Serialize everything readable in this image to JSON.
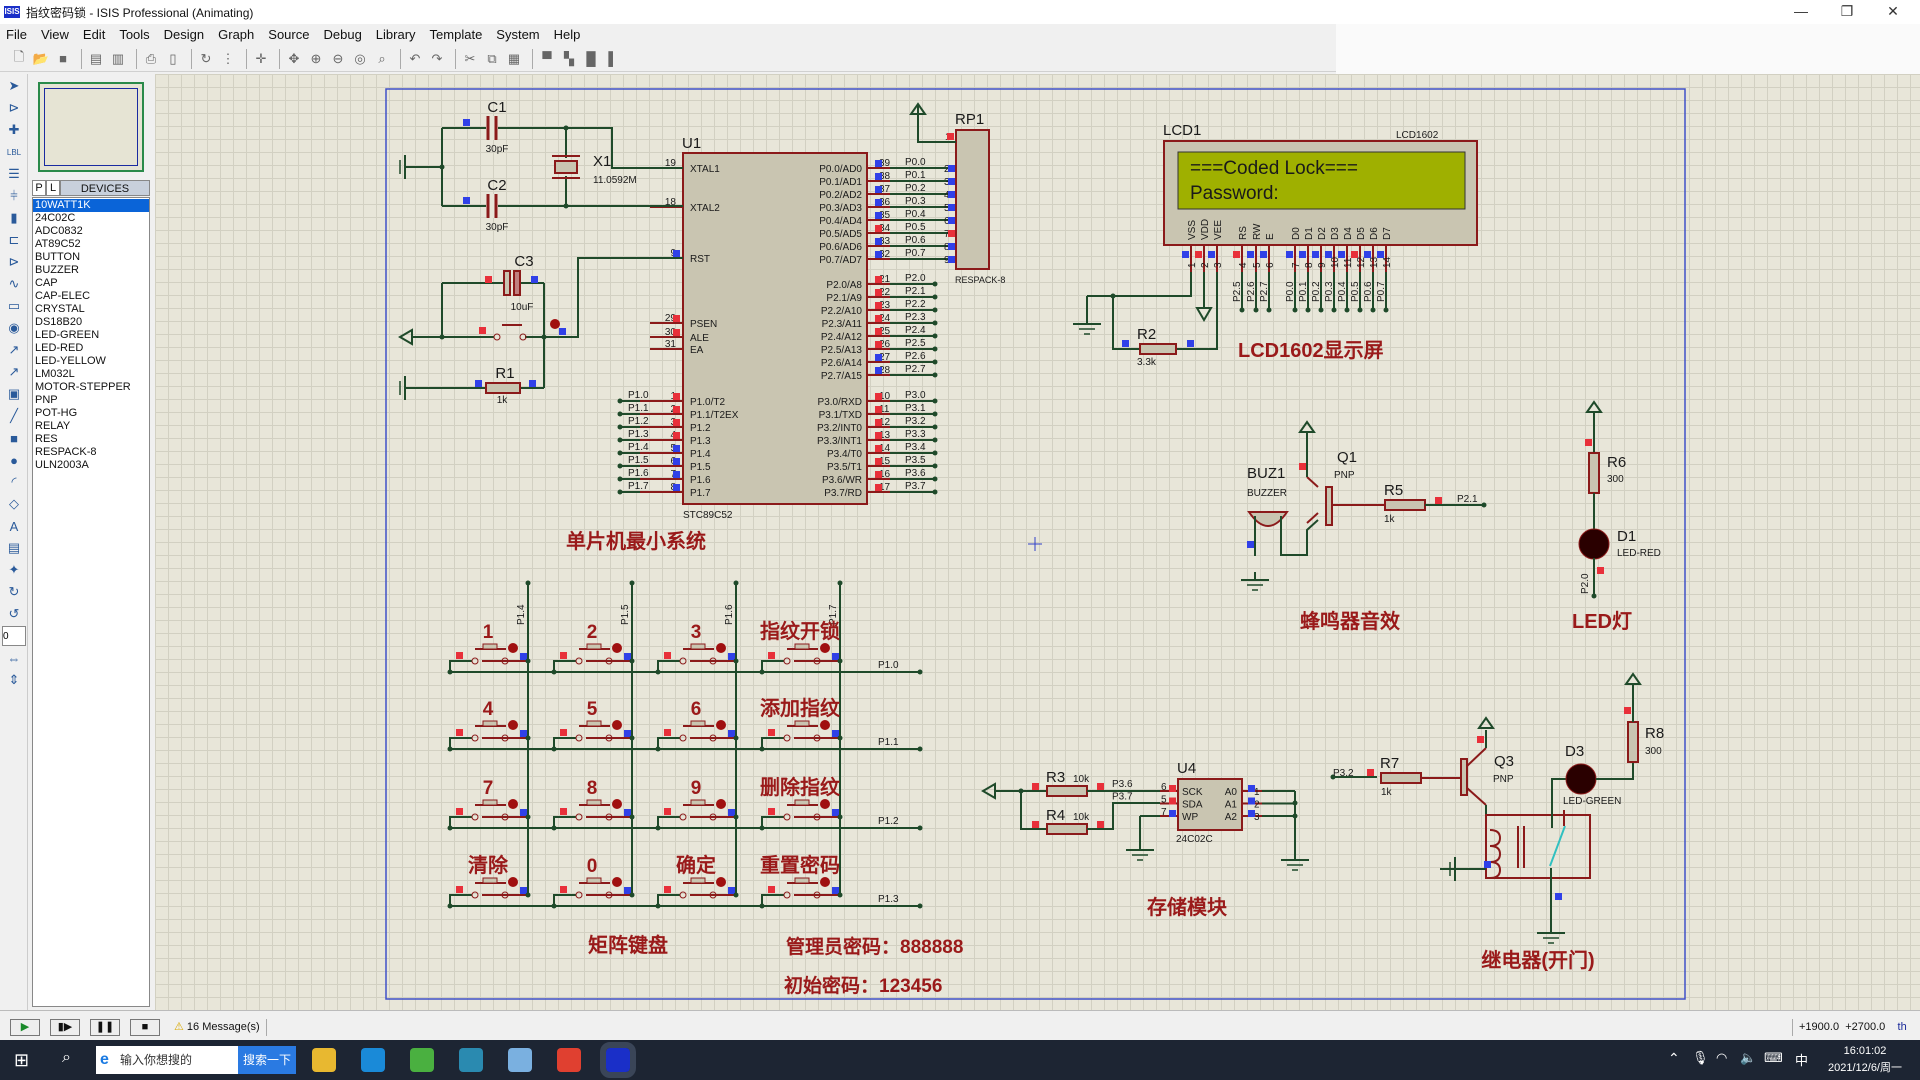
{
  "window": {
    "title": "指纹密码锁 - ISIS Professional (Animating)",
    "app_icon": "ISIS",
    "minimize": "—",
    "maximize": "❐",
    "close": "✕"
  },
  "menu": [
    "File",
    "View",
    "Edit",
    "Tools",
    "Design",
    "Graph",
    "Source",
    "Debug",
    "Library",
    "Template",
    "System",
    "Help"
  ],
  "toolbar": [
    "new-icon",
    "open-icon",
    "save-icon",
    "|",
    "import-icon",
    "export-icon",
    "|",
    "print-icon",
    "print-area-icon",
    "|",
    "refresh-icon",
    "grid-icon",
    "|",
    "origin-icon",
    "|",
    "pan-icon",
    "zoom-in-icon",
    "zoom-out-icon",
    "zoom-all-icon",
    "zoom-area-icon",
    "|",
    "undo-icon",
    "redo-icon",
    "|",
    "cut-icon",
    "copy-icon",
    "paste-icon",
    "|",
    "block-copy-icon",
    "block-move-icon",
    "block-rotate-icon",
    "block-delete-icon"
  ],
  "tools": [
    "selection-icon",
    "component-icon",
    "junction-icon",
    "wire-label-icon",
    "text-script-icon",
    "bus-icon",
    "subcircuit-icon",
    "terminal-icon",
    "device-pin-icon",
    "graph-icon",
    "tape-icon",
    "generator-icon",
    "voltage-probe-icon",
    "current-probe-icon",
    "virtual-instrument-icon",
    "line-icon",
    "box-icon",
    "circle-icon",
    "arc-icon",
    "path-icon",
    "text-icon",
    "symbol-icon",
    "marker-icon",
    "rotate-cw-icon",
    "rotate-ccw-icon",
    "angle-field",
    "mirror-x-icon",
    "mirror-y-icon"
  ],
  "tools_angle": "0",
  "devices": {
    "tab_p": "P",
    "tab_l": "L",
    "header": "DEVICES",
    "selected": "10WATT1K",
    "items": [
      "10WATT1K",
      "24C02C",
      "ADC0832",
      "AT89C52",
      "BUTTON",
      "BUZZER",
      "CAP",
      "CAP-ELEC",
      "CRYSTAL",
      "DS18B20",
      "LED-GREEN",
      "LED-RED",
      "LED-YELLOW",
      "LM032L",
      "MOTOR-STEPPER",
      "PNP",
      "POT-HG",
      "RELAY",
      "RES",
      "RESPACK-8",
      "ULN2003A"
    ]
  },
  "colors": {
    "wire": "#1f4a2a",
    "outline": "#8b1a1a",
    "body": "#c9c5b1",
    "pin_high": "#e8303a",
    "pin_low": "#3040e8",
    "lcd_screen": "#9fb000",
    "label": "#9a1a1a"
  },
  "schematic": {
    "u1": {
      "ref": "U1",
      "part": "STC89C52",
      "left_pins": [
        {
          "num": "19",
          "name": "XTAL1"
        },
        {
          "num": "18",
          "name": "XTAL2"
        },
        {
          "num": "9",
          "name": "RST",
          "state": "low"
        },
        {
          "num": "29",
          "name": "PSEN",
          "state": "high"
        },
        {
          "num": "30",
          "name": "ALE",
          "state": "high"
        },
        {
          "num": "31",
          "name": "EA",
          "state": "none"
        },
        {
          "num": "1",
          "name": "P1.0/T2",
          "net": "P1.0",
          "state": "high"
        },
        {
          "num": "2",
          "name": "P1.1/T2EX",
          "net": "P1.1",
          "state": "high"
        },
        {
          "num": "3",
          "name": "P1.2",
          "net": "P1.2",
          "state": "high"
        },
        {
          "num": "4",
          "name": "P1.3",
          "net": "P1.3",
          "state": "high"
        },
        {
          "num": "5",
          "name": "P1.4",
          "net": "P1.4",
          "state": "low"
        },
        {
          "num": "6",
          "name": "P1.5",
          "net": "P1.5",
          "state": "low"
        },
        {
          "num": "7",
          "name": "P1.6",
          "net": "P1.6",
          "state": "low"
        },
        {
          "num": "8",
          "name": "P1.7",
          "net": "P1.7",
          "state": "low"
        }
      ],
      "p0_pins": [
        {
          "num": "39",
          "name": "P0.0/AD0",
          "net": "P0.0",
          "state": "low"
        },
        {
          "num": "38",
          "name": "P0.1/AD1",
          "net": "P0.1",
          "state": "low"
        },
        {
          "num": "37",
          "name": "P0.2/AD2",
          "net": "P0.2",
          "state": "low"
        },
        {
          "num": "36",
          "name": "P0.3/AD3",
          "net": "P0.3",
          "state": "low"
        },
        {
          "num": "35",
          "name": "P0.4/AD4",
          "net": "P0.4",
          "state": "low"
        },
        {
          "num": "34",
          "name": "P0.5/AD5",
          "net": "P0.5",
          "state": "high"
        },
        {
          "num": "33",
          "name": "P0.6/AD6",
          "net": "P0.6",
          "state": "low"
        },
        {
          "num": "32",
          "name": "P0.7/AD7",
          "net": "P0.7",
          "state": "low"
        }
      ],
      "p2_pins": [
        {
          "num": "21",
          "name": "P2.0/A8",
          "net": "P2.0",
          "state": "high"
        },
        {
          "num": "22",
          "name": "P2.1/A9",
          "net": "P2.1",
          "state": "high"
        },
        {
          "num": "23",
          "name": "P2.2/A10",
          "net": "P2.2",
          "state": "high"
        },
        {
          "num": "24",
          "name": "P2.3/A11",
          "net": "P2.3",
          "state": "high"
        },
        {
          "num": "25",
          "name": "P2.4/A12",
          "net": "P2.4",
          "state": "high"
        },
        {
          "num": "26",
          "name": "P2.5/A13",
          "net": "P2.5",
          "state": "high"
        },
        {
          "num": "27",
          "name": "P2.6/A14",
          "net": "P2.6",
          "state": "low"
        },
        {
          "num": "28",
          "name": "P2.7/A15",
          "net": "P2.7",
          "state": "low"
        }
      ],
      "p3_pins": [
        {
          "num": "10",
          "name": "P3.0/RXD",
          "net": "P3.0"
        },
        {
          "num": "11",
          "name": "P3.1/TXD",
          "net": "P3.1"
        },
        {
          "num": "12",
          "name": "P3.2/INT0",
          "net": "P3.2"
        },
        {
          "num": "13",
          "name": "P3.3/INT1",
          "net": "P3.3"
        },
        {
          "num": "14",
          "name": "P3.4/T0",
          "net": "P3.4"
        },
        {
          "num": "15",
          "name": "P3.5/T1",
          "net": "P3.5"
        },
        {
          "num": "16",
          "name": "P3.6/WR",
          "net": "P3.6"
        },
        {
          "num": "17",
          "name": "P3.7/RD",
          "net": "P3.7"
        }
      ]
    },
    "rp1": {
      "ref": "RP1",
      "part": "RESPACK-8",
      "pins": [
        "1",
        "2",
        "3",
        "4",
        "5",
        "6",
        "7",
        "8",
        "9"
      ]
    },
    "c1": {
      "ref": "C1",
      "value": "30pF"
    },
    "c2": {
      "ref": "C2",
      "value": "30pF"
    },
    "c3": {
      "ref": "C3",
      "value": "10uF"
    },
    "x1": {
      "ref": "X1",
      "value": "11.0592M"
    },
    "r1": {
      "ref": "R1",
      "value": "1k"
    },
    "r2": {
      "ref": "R2",
      "value": "3.3k"
    },
    "lcd": {
      "ref": "LCD1",
      "part": "LCD1602",
      "line1": "===Coded Lock===",
      "line2": "Password:",
      "pins": [
        {
          "num": "1",
          "name": "VSS",
          "state": "low"
        },
        {
          "num": "2",
          "name": "VDD",
          "state": "high"
        },
        {
          "num": "3",
          "name": "VEE",
          "state": "low"
        },
        {
          "num": "4",
          "name": "RS",
          "net": "P2.5",
          "state": "high"
        },
        {
          "num": "5",
          "name": "RW",
          "net": "P2.6",
          "state": "low"
        },
        {
          "num": "6",
          "name": "E",
          "net": "P2.7",
          "state": "low"
        },
        {
          "num": "7",
          "name": "D0",
          "net": "P0.0",
          "state": "low"
        },
        {
          "num": "8",
          "name": "D1",
          "net": "P0.1",
          "state": "low"
        },
        {
          "num": "9",
          "name": "D2",
          "net": "P0.2",
          "state": "low"
        },
        {
          "num": "10",
          "name": "D3",
          "net": "P0.3",
          "state": "low"
        },
        {
          "num": "11",
          "name": "D4",
          "net": "P0.4",
          "state": "low"
        },
        {
          "num": "12",
          "name": "D5",
          "net": "P0.5",
          "state": "high"
        },
        {
          "num": "13",
          "name": "D6",
          "net": "P0.6",
          "state": "low"
        },
        {
          "num": "14",
          "name": "D7",
          "net": "P0.7",
          "state": "low"
        }
      ]
    },
    "buz1": {
      "ref": "BUZ1",
      "part": "BUZZER"
    },
    "q1": {
      "ref": "Q1",
      "part": "PNP"
    },
    "r5": {
      "ref": "R5",
      "value": "1k",
      "net": "P2.1"
    },
    "r6": {
      "ref": "R6",
      "value": "300"
    },
    "d1": {
      "ref": "D1",
      "part": "LED-RED",
      "net": "P2.0"
    },
    "keypad": {
      "keys": [
        "1",
        "2",
        "3",
        "指纹开锁",
        "4",
        "5",
        "6",
        "添加指纹",
        "7",
        "8",
        "9",
        "删除指纹",
        "清除",
        "0",
        "确定",
        "重置密码"
      ],
      "col_nets": [
        "P1.4",
        "P1.5",
        "P1.6",
        "P1.7"
      ],
      "row_nets": [
        "P1.0",
        "P1.1",
        "P1.2",
        "P1.3"
      ]
    },
    "u4": {
      "ref": "U4",
      "part": "24C02C",
      "left_pins": [
        {
          "num": "6",
          "name": "SCK",
          "net": "P3.6"
        },
        {
          "num": "5",
          "name": "SDA",
          "net": "P3.7"
        },
        {
          "num": "7",
          "name": "WP"
        }
      ],
      "right_pins": [
        {
          "num": "1",
          "name": "A0"
        },
        {
          "num": "2",
          "name": "A1"
        },
        {
          "num": "3",
          "name": "A2"
        }
      ]
    },
    "r3": {
      "ref": "R3",
      "value": "10k"
    },
    "r4": {
      "ref": "R4",
      "value": "10k"
    },
    "r7": {
      "ref": "R7",
      "value": "1k",
      "net": "P3.2"
    },
    "q3": {
      "ref": "Q3",
      "part": "PNP"
    },
    "d3": {
      "ref": "D3",
      "part": "LED-GREEN"
    },
    "r8": {
      "ref": "R8",
      "value": "300"
    },
    "labels": {
      "mcu": "单片机最小系统",
      "lcd": "LCD1602显示屏",
      "buzzer": "蜂鸣器音效",
      "led": "LED灯",
      "keypad": "矩阵键盘",
      "eeprom": "存储模块",
      "relay": "继电器(开门)",
      "admin_password": "管理员密码：888888",
      "initial_password": "初始密码：123456"
    }
  },
  "status": {
    "play": "▶",
    "step": "▮▶",
    "pause": "❚❚",
    "stop": "■",
    "messages": "16 Message(s)",
    "x": "+1900.0",
    "y": "+2700.0",
    "unit": "th"
  },
  "taskbar": {
    "search_placeholder": "输入你想搜的",
    "search_button": "搜索一下",
    "ime": "中",
    "time": "16:01:02",
    "date": "2021/12/6/周一",
    "apps": [
      "file-explorer-icon",
      "edge-icon",
      "browser-icon",
      "app-icon",
      "paint-icon",
      "office-icon",
      "isis-icon"
    ]
  }
}
